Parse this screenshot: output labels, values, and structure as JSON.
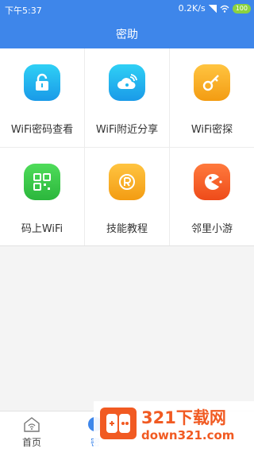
{
  "status_bar": {
    "time": "下午5:37",
    "network_speed": "0.2K/s",
    "battery": "100"
  },
  "header": {
    "title": "密助"
  },
  "tools": [
    {
      "label": "WiFi密码查看",
      "icon": "unlock-icon",
      "color": "#1fb7ee"
    },
    {
      "label": "WiFi附近分享",
      "icon": "cloud-share-icon",
      "color": "#1fb7ee"
    },
    {
      "label": "WiFi密探",
      "icon": "key-icon",
      "color": "#f5a623"
    },
    {
      "label": "码上WiFi",
      "icon": "qr-code-icon",
      "color": "#39c24b"
    },
    {
      "label": "技能教程",
      "icon": "tutorial-icon",
      "color": "#f5a623"
    },
    {
      "label": "邻里小游",
      "icon": "pacman-icon",
      "color": "#f15a22"
    }
  ],
  "bottom_nav": {
    "home_label": "首页",
    "mi_label": "密"
  },
  "watermark": {
    "big_text": "321下载网",
    "small_text": "down321.com"
  }
}
